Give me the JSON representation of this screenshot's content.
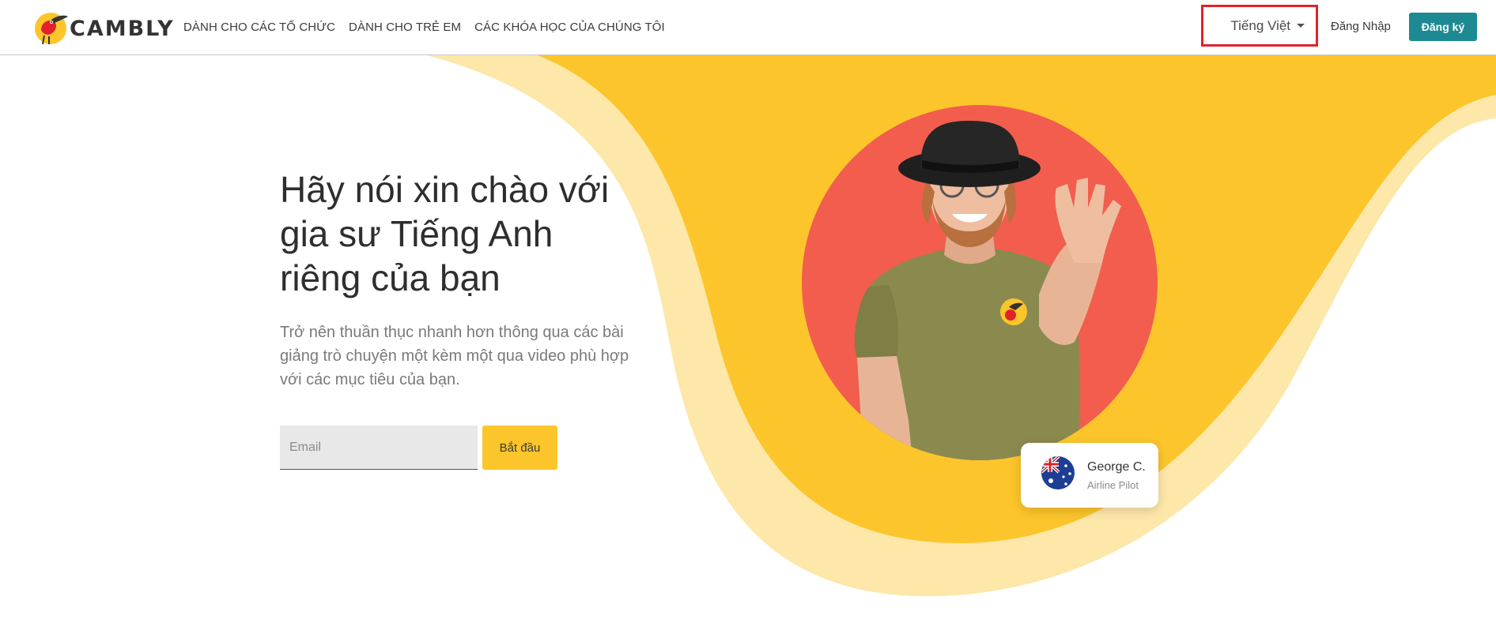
{
  "header": {
    "logo_text": "CAMBLY",
    "nav": [
      {
        "label": "DÀNH CHO CÁC TỔ CHỨC"
      },
      {
        "label": "DÀNH CHO TRẺ EM"
      },
      {
        "label": "CÁC KHÓA HỌC CỦA CHÚNG TÔI"
      }
    ],
    "language": "Tiếng Việt",
    "login_label": "Đăng Nhập",
    "signup_label": "Đăng ký"
  },
  "hero": {
    "title": "Hãy nói xin chào với gia sư Tiếng Anh riêng của bạn",
    "subtitle": "Trở nên thuần thục nhanh hơn thông qua các bài giảng trò chuyện một kèm một qua video phù hợp với các mục tiêu của bạn.",
    "email_placeholder": "Email",
    "start_label": "Bắt đầu"
  },
  "tutor": {
    "name": "George C.",
    "role": "Airline Pilot",
    "flag_icon": "australia-flag-icon"
  },
  "colors": {
    "brand_teal": "#1d8a93",
    "yellow": "#fcc52b",
    "light_yellow": "#fde7a9",
    "coral": "#f25d4d",
    "highlight_red": "#e1222a"
  }
}
